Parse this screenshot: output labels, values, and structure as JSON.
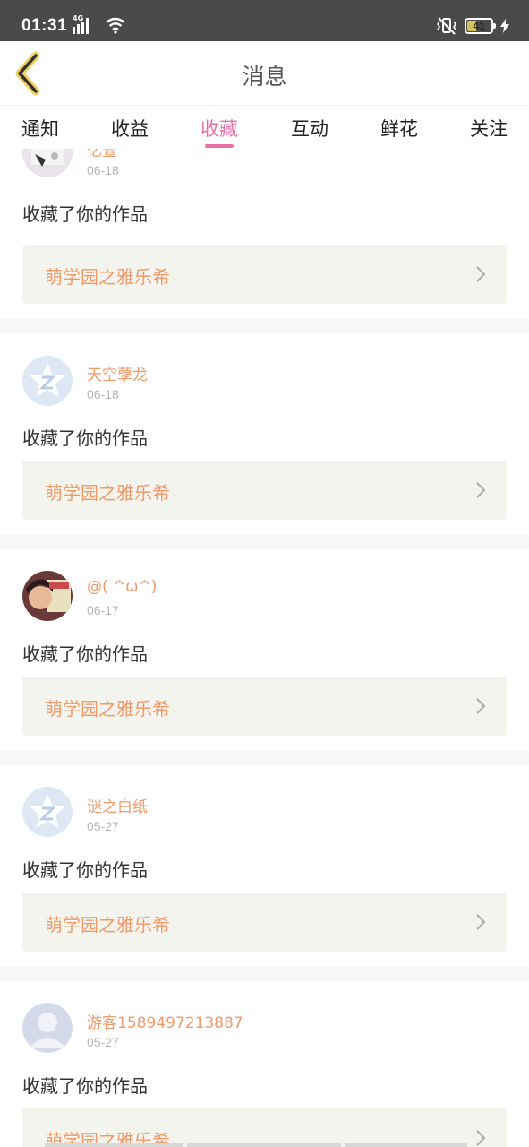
{
  "status_bar": {
    "time": "01:31",
    "network": "4G",
    "battery": "41",
    "battery_level": 0.41
  },
  "header": {
    "title": "消息"
  },
  "tabs": [
    {
      "label": "通知"
    },
    {
      "label": "收益"
    },
    {
      "label": "收藏",
      "active": true
    },
    {
      "label": "互动"
    },
    {
      "label": "鲜花"
    },
    {
      "label": "关注"
    }
  ],
  "messages": [
    {
      "user": "亿萱",
      "date": "06-18",
      "action": "收藏了你的作品",
      "work": "萌学园之雅乐希",
      "avatar": "photo-avatar"
    },
    {
      "user": "天空孽龙",
      "date": "06-18",
      "action": "收藏了你的作品",
      "work": "萌学园之雅乐希",
      "avatar": "default-star-avatar"
    },
    {
      "user": "@( ^ω^)",
      "date": "06-17",
      "action": "收藏了你的作品",
      "work": "萌学园之雅乐希",
      "avatar": "photo-avatar"
    },
    {
      "user": "谜之白纸",
      "date": "05-27",
      "action": "收藏了你的作品",
      "work": "萌学园之雅乐希",
      "avatar": "default-star-avatar"
    },
    {
      "user": "游客1589497213887",
      "date": "05-27",
      "action": "收藏了你的作品",
      "work": "萌学园之雅乐希",
      "avatar": "default-person-avatar"
    }
  ],
  "colors": {
    "accent": "#e872a8",
    "username": "#ef9a6a",
    "work_box": "#f4f4ee",
    "status_bar": "#4a4a4a"
  }
}
